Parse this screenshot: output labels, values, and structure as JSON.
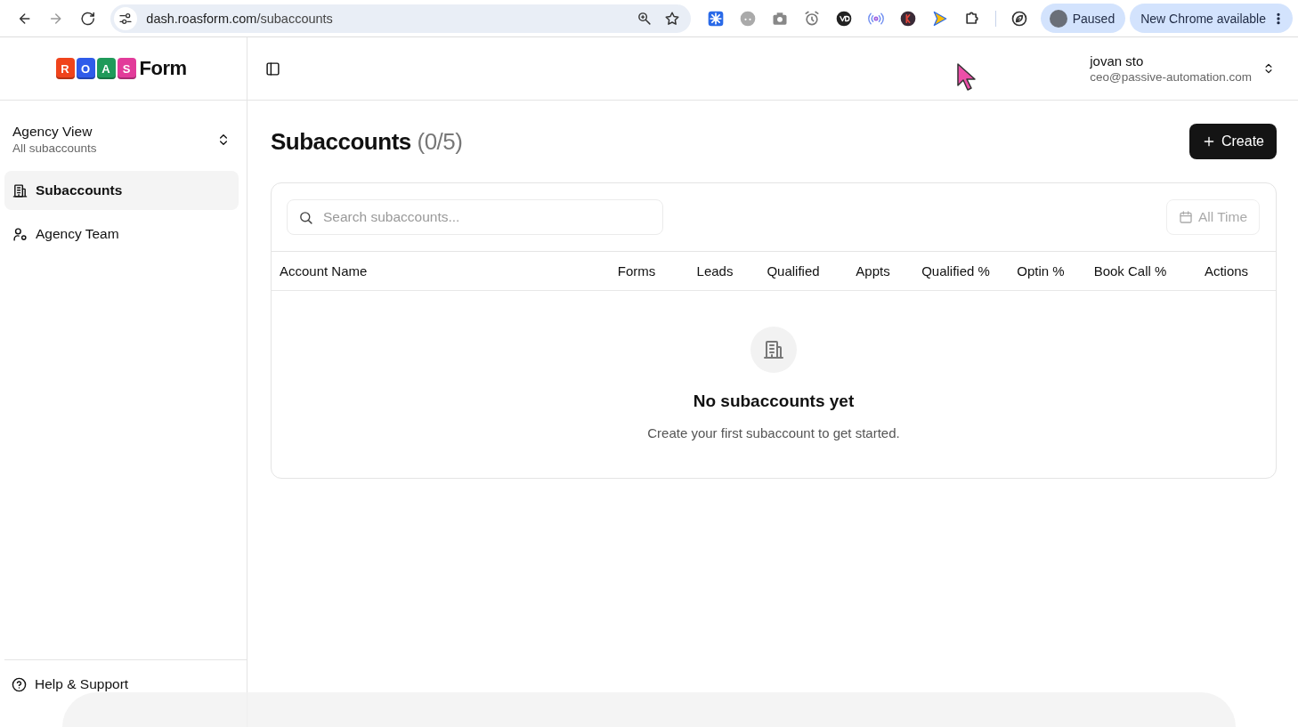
{
  "browser": {
    "url_host": "dash.roasform.com",
    "url_path": "/subaccounts",
    "profile_label": "Paused",
    "update_label": "New Chrome available"
  },
  "sidebar": {
    "logo": {
      "tiles": [
        {
          "letter": "R",
          "color": "#f0441c"
        },
        {
          "letter": "O",
          "color": "#2f5bea"
        },
        {
          "letter": "A",
          "color": "#1f9a5a"
        },
        {
          "letter": "S",
          "color": "#e23b9a"
        }
      ],
      "word": "Form"
    },
    "switcher": {
      "title": "Agency View",
      "subtitle": "All subaccounts"
    },
    "items": [
      {
        "kind": "building",
        "label": "Subaccounts",
        "selected": true
      },
      {
        "kind": "team",
        "label": "Agency Team",
        "selected": false
      }
    ],
    "footer": {
      "kind": "help",
      "label": "Help & Support"
    }
  },
  "header": {
    "user": {
      "name": "jovan sto",
      "email": "ceo@passive-automation.com"
    }
  },
  "page": {
    "title": "Subaccounts",
    "count": "(0/5)",
    "create_button": "Create",
    "search": {
      "placeholder": "Search subaccounts..."
    },
    "date_filter": "All Time",
    "table": {
      "columns": [
        "Account Name",
        "Forms",
        "Leads",
        "Qualified",
        "Appts",
        "Qualified %",
        "Optin %",
        "Book Call %",
        "Actions"
      ],
      "empty": {
        "title": "No subaccounts yet",
        "message": "Create your first subaccount to get started."
      }
    }
  }
}
